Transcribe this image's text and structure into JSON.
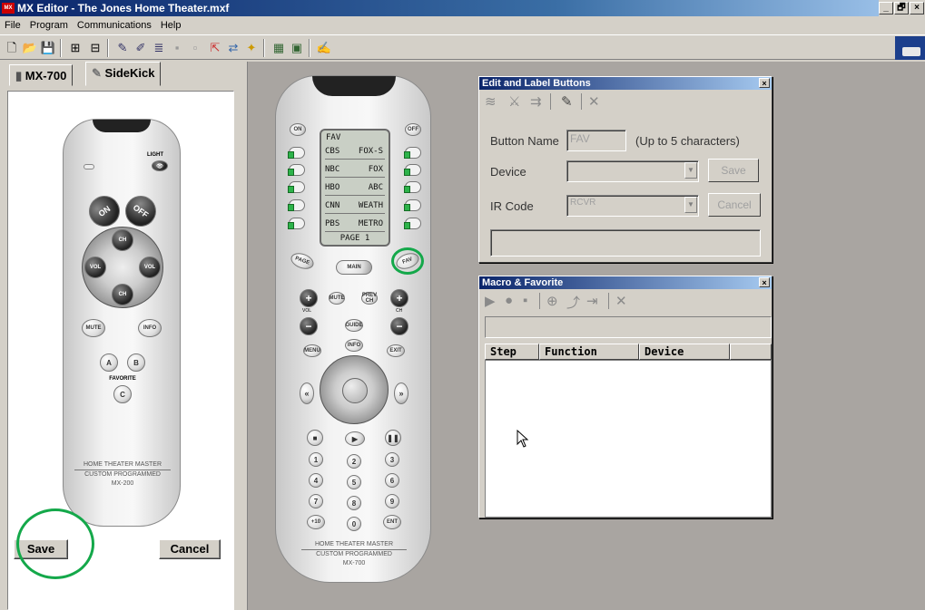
{
  "window": {
    "app_icon": "MX",
    "title": "MX Editor - The Jones Home Theater.mxf",
    "controls": [
      "_",
      "🗗",
      "×"
    ]
  },
  "menu": [
    "File",
    "Program",
    "Communications",
    "Help"
  ],
  "left_panel": {
    "tabs": [
      {
        "label": "MX-700",
        "icon": "remote-icon"
      },
      {
        "label": "SideKick",
        "icon": "sidekick-icon"
      }
    ],
    "active_tab": "SideKick",
    "sidekick_remote": {
      "light_label": "LIGHT",
      "on": "ON",
      "off": "OFF",
      "ch": "CH",
      "vol": "VOL",
      "mute": "MUTE",
      "info": "INFO",
      "a": "A",
      "b": "B",
      "c": "C",
      "favorite": "FAVORITE",
      "brand_line1": "HOME THEATER MASTER",
      "brand_line2": "CUSTOM PROGRAMMED",
      "model": "MX-200"
    },
    "save_label": "Save",
    "cancel_label": "Cancel",
    "highlight_color": "#14a84a"
  },
  "mx700_remote": {
    "on": "ON",
    "off": "OFF",
    "lcd_header": "FAV",
    "lcd_rows": [
      [
        "CBS",
        "FOX-S"
      ],
      [
        "NBC",
        "FOX"
      ],
      [
        "HBO",
        "ABC"
      ],
      [
        "CNN",
        "WEATH"
      ],
      [
        "PBS",
        "METRO"
      ]
    ],
    "lcd_footer": "PAGE 1",
    "page": "PAGE",
    "main": "MAIN",
    "fav": "FAV",
    "mute": "MUTE",
    "prev_ch": "PREV CH",
    "guide": "GUIDE",
    "vol": "VOL",
    "ch": "CH",
    "menu": "MENU",
    "info": "INFO",
    "exit": "EXIT",
    "numbers": [
      "1",
      "2",
      "3",
      "4",
      "5",
      "6",
      "7",
      "8",
      "9",
      "+10",
      "0",
      "ENT"
    ],
    "brand_line1": "HOME THEATER MASTER",
    "brand_line2": "CUSTOM PROGRAMMED",
    "model": "MX-700"
  },
  "edit_label_dialog": {
    "title": "Edit and Label Buttons",
    "button_name_label": "Button Name",
    "button_name_value": "FAV",
    "button_name_hint": "(Up to 5 characters)",
    "device_label": "Device",
    "device_value": "",
    "ir_code_label": "IR Code",
    "ir_code_value": "RCVR",
    "save_label": "Save",
    "cancel_label": "Cancel"
  },
  "macro_dialog": {
    "title": "Macro & Favorite",
    "columns": [
      "Step",
      "Function",
      "Device"
    ]
  }
}
